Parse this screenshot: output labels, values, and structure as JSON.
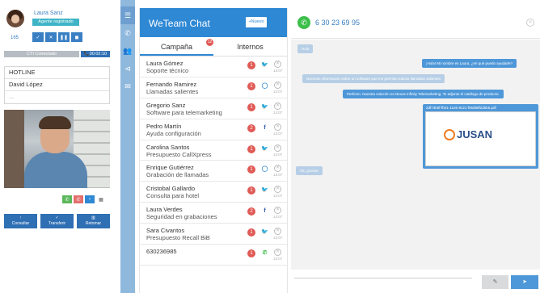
{
  "agent": {
    "name": "Laura Sanz",
    "status": "Agente registrado",
    "extension": "165",
    "controls": [
      "✓",
      "✕",
      "❚❚",
      "◼"
    ],
    "connection": "CTI Conectado",
    "timer": "📞00:02:10"
  },
  "call_info": {
    "line": "HOTLINE",
    "caller": "David López",
    "extra": "..."
  },
  "call_controls": [
    "✆",
    "✆",
    "›",
    "▦"
  ],
  "actions": {
    "consult": "Consultar",
    "transfer": "Transferir",
    "retrieve": "Retomar"
  },
  "nav": [
    "☰",
    "✆",
    "👥",
    "⊲",
    "✉"
  ],
  "chat": {
    "title": "WeTeam Chat",
    "new_button": "+Nuevo",
    "tabs": {
      "campaign": "Campaña",
      "internal": "Internos",
      "badge": "12"
    },
    "contacts": [
      {
        "name": "Laura Gómez",
        "subject": "Soporte técnico",
        "badge": "1",
        "channel": "twitter",
        "time": "13:07"
      },
      {
        "name": "Fernando Ramirez",
        "subject": "Llamadas salientes",
        "badge": "1",
        "channel": "circle",
        "time": "13:07"
      },
      {
        "name": "Gregorio Sanz",
        "subject": "Software para telemarketing",
        "badge": "1",
        "channel": "twitter",
        "time": "13:07"
      },
      {
        "name": "Pedro Martín",
        "subject": "Ayuda configuración",
        "badge": "2",
        "channel": "facebook",
        "time": "13:07"
      },
      {
        "name": "Carolina Santos",
        "subject": "Presupuesto CallXpress",
        "badge": "1",
        "channel": "twitter",
        "time": "13:07"
      },
      {
        "name": "Enrique Gutiérrez",
        "subject": "Grabación de llamadas",
        "badge": "1",
        "channel": "circle",
        "time": "13:07"
      },
      {
        "name": "Cristobal Gallardo",
        "subject": "Consulta para hotel",
        "badge": "1",
        "channel": "twitter",
        "time": "13:07"
      },
      {
        "name": "Laura Verdes",
        "subject": "Seguridad en grabaciones",
        "badge": "2",
        "channel": "facebook",
        "time": "13:07"
      },
      {
        "name": "Sara Civantos",
        "subject": "Presupuesto Recall BiB",
        "badge": "1",
        "channel": "twitter",
        "time": "13:07"
      },
      {
        "name": "630236985",
        "subject": "",
        "badge": "1",
        "channel": "whatsapp",
        "time": "13:07"
      }
    ]
  },
  "conversation": {
    "phone": "6 30 23 69 95",
    "messages": [
      {
        "dir": "in",
        "text": "Hola"
      },
      {
        "dir": "out",
        "text": "¡Hola! Mi nombre es Laura, ¿en qué puedo ayudarle?"
      },
      {
        "dir": "in",
        "text": "Necesito información sobre un software que me permita realizar llamadas salientes"
      },
      {
        "dir": "out",
        "text": "Perfecto. Nuestra solución es Nexus Infinity Telemarketing. Te adjunto el catálogo de producto."
      },
      {
        "dir": "in",
        "text": "Ok, gracias"
      }
    ],
    "attachment": {
      "name": "2df73b8f-fb01-11e5-9c21-f06d98f2d5b5.pdf",
      "logo": "JUSAN"
    },
    "attach_button": "✎",
    "send_button": "➤"
  },
  "colors": {
    "primary": "#2e88d4",
    "rail": "#8fb8dd",
    "badge": "#e05a55",
    "whatsapp": "#3cbf4a"
  }
}
